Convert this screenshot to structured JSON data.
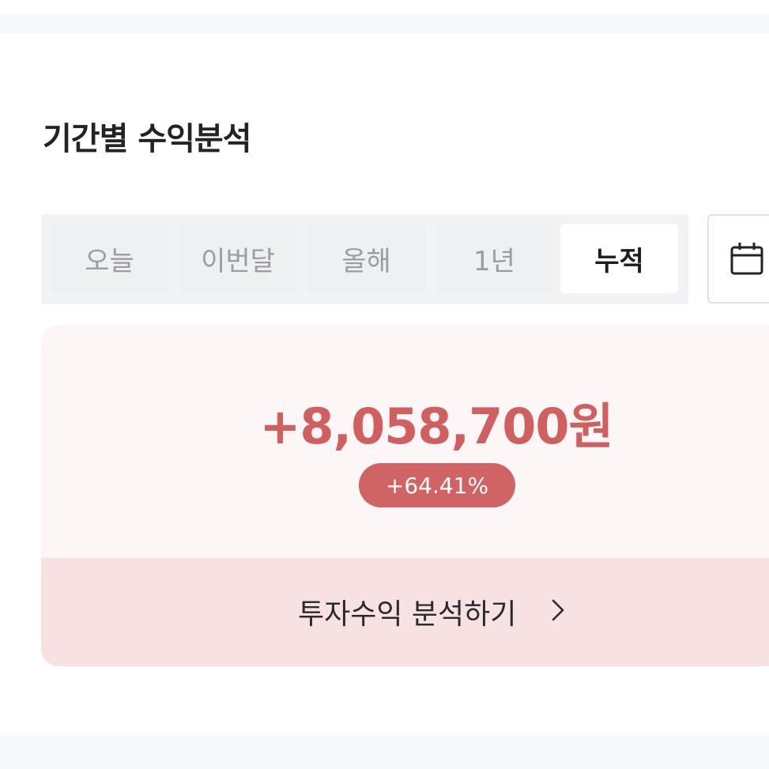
{
  "section": {
    "title": "기간별 수익분석"
  },
  "period_tabs": [
    {
      "label": "오늘",
      "active": false
    },
    {
      "label": "이번달",
      "active": false
    },
    {
      "label": "올해",
      "active": false
    },
    {
      "label": "1년",
      "active": false
    },
    {
      "label": "누적",
      "active": true
    }
  ],
  "calendar_button": {
    "icon": "calendar-icon"
  },
  "summary": {
    "amount": "+8,058,700원",
    "rate": "+64.41%",
    "accent_color": "#d0605f",
    "card_background": "#fdf6f6",
    "action_background": "#f8e1e2"
  },
  "action": {
    "label": "투자수익 분석하기",
    "icon": "chevron-right-icon"
  }
}
